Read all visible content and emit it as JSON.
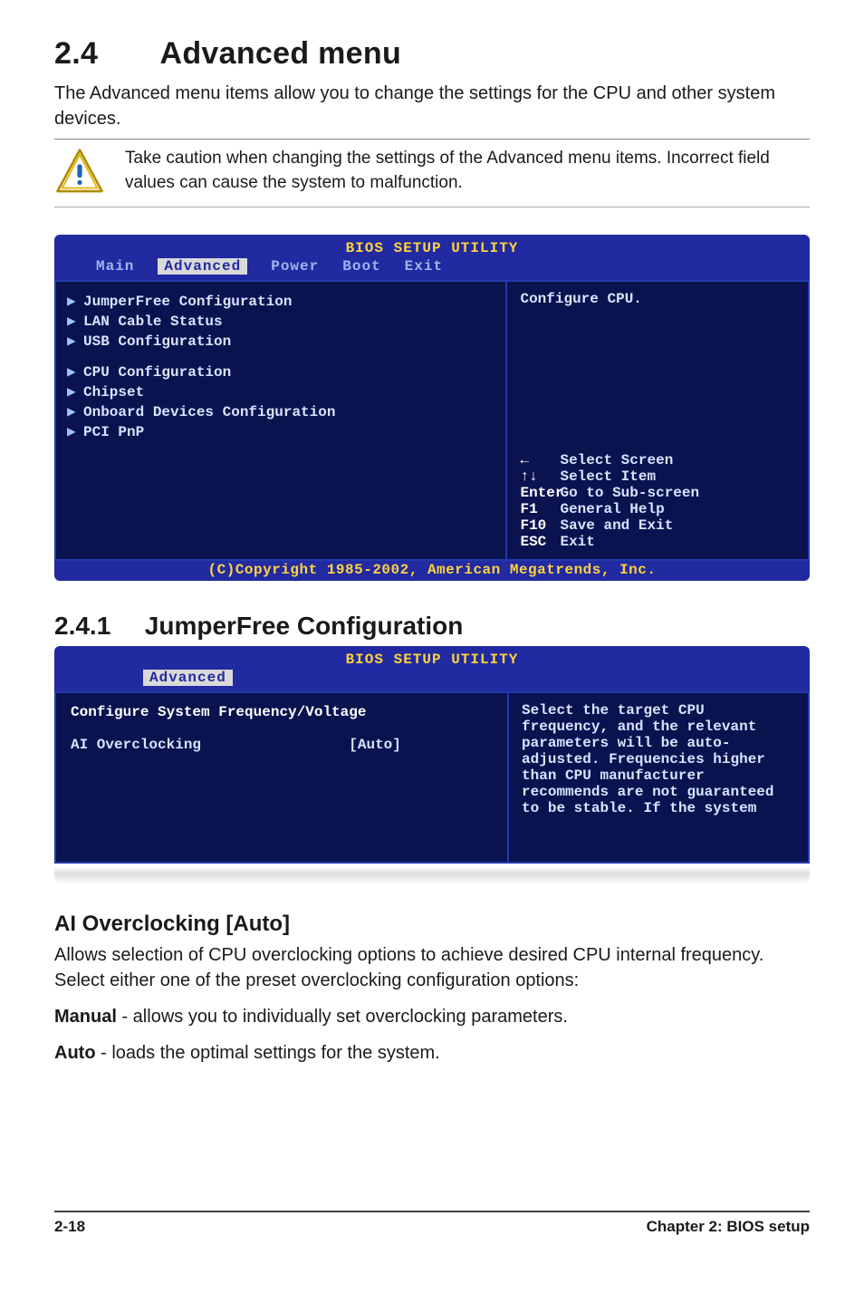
{
  "page": {
    "title_num": "2.4",
    "title_text": "Advanced menu",
    "intro": "The Advanced menu items allow you to change the settings for the CPU and other system devices.",
    "caution": "Take caution when changing the settings of the Advanced menu items. Incorrect field values can cause the system to malfunction."
  },
  "bios1": {
    "top_title": "BIOS SETUP UTILITY",
    "tabs": {
      "main": "Main",
      "advanced": "Advanced",
      "power": "Power",
      "boot": "Boot",
      "exit": "Exit"
    },
    "items_group1": [
      "JumperFree Configuration",
      "LAN Cable Status",
      "USB Configuration"
    ],
    "items_group2": [
      "CPU Configuration",
      "Chipset",
      "Onboard Devices Configuration",
      "PCI PnP"
    ],
    "right_help": "Configure CPU.",
    "keys": {
      "r1a": "←",
      "r1b": "Select Screen",
      "r2a": "↑↓",
      "r2b": "Select Item",
      "r3a": "Enter",
      "r3b": "Go to Sub-screen",
      "r4a": "F1",
      "r4b": "General Help",
      "r5a": "F10",
      "r5b": "Save and Exit",
      "r6a": "ESC",
      "r6b": "Exit"
    },
    "footer": "(C)Copyright 1985-2002, American Megatrends, Inc."
  },
  "section": {
    "num": "2.4.1",
    "title": "JumperFree Configuration"
  },
  "bios2": {
    "top_title": "BIOS SETUP UTILITY",
    "tab": "Advanced",
    "header": "Configure System Frequency/Voltage",
    "field_label": "AI Overclocking",
    "field_value": "[Auto]",
    "help": "Select the target CPU frequency, and the relevant parameters will be auto-adjusted. Frequencies higher than CPU manufacturer recommends are not guaranteed to be stable. If the system"
  },
  "ai": {
    "heading": "AI Overclocking [Auto]",
    "desc": "Allows selection of CPU overclocking options to achieve desired CPU internal frequency. Select either one of the preset overclocking configuration options:",
    "manual_label": "Manual",
    "manual_text": " - allows you to individually set overclocking parameters.",
    "auto_label": "Auto",
    "auto_text": " - loads the optimal settings for the system."
  },
  "footer": {
    "left": "2-18",
    "right": "Chapter 2: BIOS setup"
  }
}
